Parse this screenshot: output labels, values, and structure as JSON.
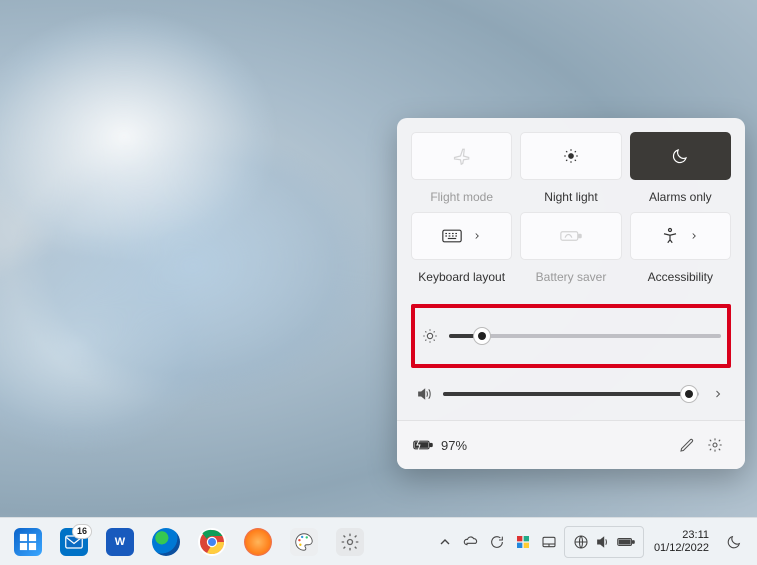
{
  "panel": {
    "tiles": [
      {
        "label": "Flight mode",
        "icon": "airplane",
        "dim": true
      },
      {
        "label": "Night light",
        "icon": "sun-dot"
      },
      {
        "label": "Alarms only",
        "icon": "moon",
        "active": true
      },
      {
        "label": "Keyboard layout",
        "icon": "keyboard",
        "chevron": true
      },
      {
        "label": "Battery saver",
        "icon": "battery-leaf",
        "dim": true
      },
      {
        "label": "Accessibility",
        "icon": "accessibility",
        "chevron": true
      }
    ],
    "brightness": {
      "value": 12
    },
    "volume": {
      "value": 96
    },
    "footer": {
      "battery_text": "97%"
    }
  },
  "taskbar": {
    "mail_badge": "16",
    "clock": {
      "time": "23:11",
      "date": "01/12/2022"
    }
  }
}
